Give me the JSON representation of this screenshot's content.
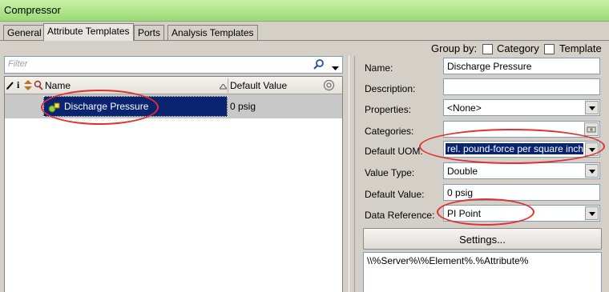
{
  "window": {
    "title": "Compressor"
  },
  "tabs": [
    "General",
    "Attribute Templates",
    "Ports",
    "Analysis Templates"
  ],
  "group_by": {
    "label": "Group by:",
    "category_label": "Category",
    "template_label": "Template",
    "category_checked": false,
    "template_checked": false
  },
  "filter": {
    "placeholder": "Filter"
  },
  "list": {
    "columns": {
      "name": "Name",
      "default_value": "Default Value"
    },
    "header_icons": [
      "pencil-icon",
      "info-icon",
      "up-down-icon",
      "magnifier-icon"
    ],
    "rows": [
      {
        "name": "Discharge Pressure",
        "default_value": "0 psig",
        "icon": "attribute-icon",
        "selected": true
      }
    ]
  },
  "details": {
    "name_label": "Name:",
    "name_value": "Discharge Pressure",
    "description_label": "Description:",
    "description_value": "",
    "properties_label": "Properties:",
    "properties_value": "<None>",
    "categories_label": "Categories:",
    "categories_value": "",
    "uom_label": "Default UOM:",
    "uom_value": "rel. pound-force per square inch",
    "value_type_label": "Value Type:",
    "value_type_value": "Double",
    "default_value_label": "Default Value:",
    "default_value_value": "0 psig",
    "data_reference_label": "Data Reference:",
    "data_reference_value": "PI Point",
    "settings_button": "Settings...",
    "config_string": "\\\\%Server%\\%Element%.%Attribute%"
  },
  "colors": {
    "titlebar": "#aee58a",
    "selection": "#0a2472",
    "highlight_ellipse": "#e03030"
  }
}
